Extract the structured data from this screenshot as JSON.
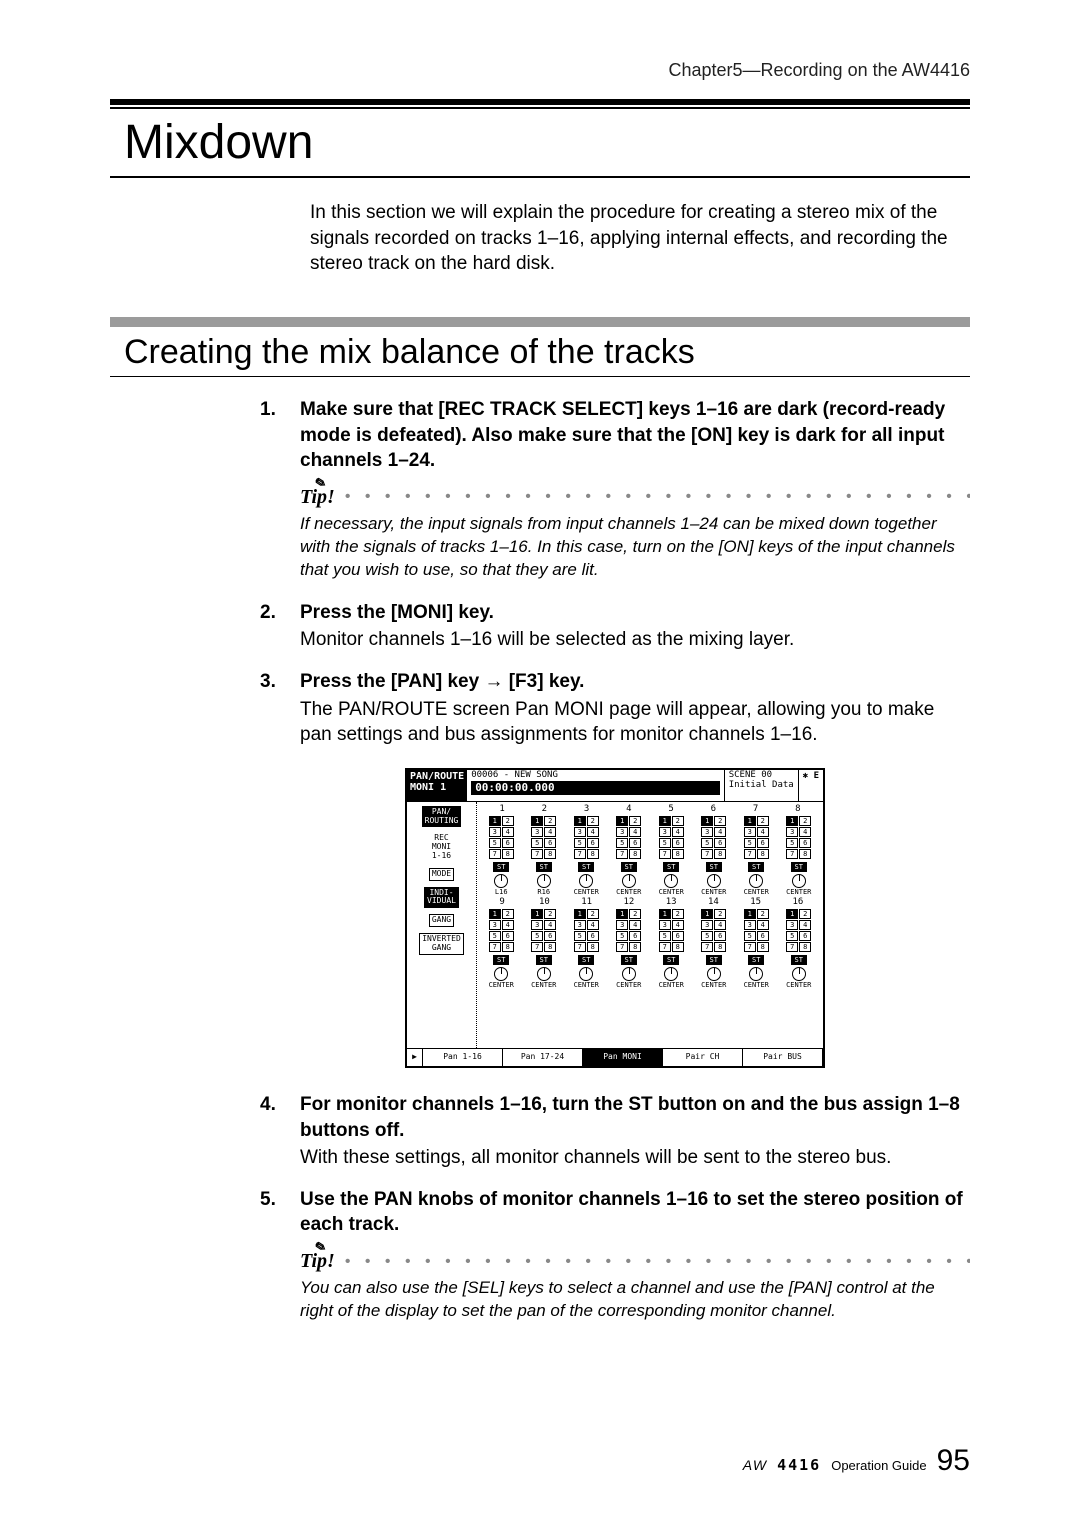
{
  "header": {
    "chapter": "Chapter5—Recording on the AW4416"
  },
  "title_main": "Mixdown",
  "intro_text": "In this section we will explain the procedure for creating a stereo mix of the signals recorded on tracks 1–16, applying internal effects, and recording the stereo track on the hard disk.",
  "title_sub": "Creating the mix balance of the tracks",
  "steps": {
    "s1": {
      "num": "1.",
      "head": "Make sure that [REC TRACK SELECT] keys 1–16 are dark (record-ready mode is defeated). Also make sure that the [ON] key is dark for all input channels 1–24."
    },
    "tip1": {
      "label": "Tip!",
      "text": "If necessary, the input signals from input channels 1–24 can be mixed down together with the signals of tracks 1–16. In this case, turn on the [ON] keys of the input channels that you wish to use, so that they are lit."
    },
    "s2": {
      "num": "2.",
      "head": "Press the [MONI] key.",
      "body": "Monitor channels 1–16 will be selected as the mixing layer."
    },
    "s3": {
      "num": "3.",
      "head": "Press the [PAN] key → [F3] key.",
      "body": "The PAN/ROUTE screen Pan MONI page will appear, allowing you to make pan settings and bus assignments for monitor channels 1–16."
    },
    "s4": {
      "num": "4.",
      "head": "For monitor channels 1–16, turn the ST button on and the bus assign 1–8 buttons off.",
      "body": "With these settings, all monitor channels will be sent to the stereo bus."
    },
    "s5": {
      "num": "5.",
      "head": "Use the PAN knobs of monitor channels 1–16 to set the stereo position of each track."
    },
    "tip2": {
      "label": "Tip!",
      "text": "You can also use the [SEL] keys to select a channel and use the [PAN] control at the right of the display to set the pan of the corresponding monitor channel."
    }
  },
  "screenshot": {
    "screen_name_top": "PAN/ROUTE",
    "screen_name_bot": "MONI 1",
    "song_info": "00006 - NEW SONG",
    "time": "00:00:00.000",
    "scene_label": "SCENE 00",
    "scene_data": "Initial Data",
    "indicator": "E",
    "left_buttons": {
      "b1": "PAN/\nROUTING",
      "b2": "REC\nMONI\n1-16",
      "b3": "MODE",
      "b4": "INDI-\nVIDUAL",
      "b5": "GANG",
      "b6": "INVERTED\nGANG"
    },
    "cols_top": [
      "1",
      "2",
      "3",
      "4",
      "5",
      "6",
      "7",
      "8"
    ],
    "cols_bot": [
      "9",
      "10",
      "11",
      "12",
      "13",
      "14",
      "15",
      "16"
    ],
    "pan_labels": {
      "p1": "L16",
      "p2": "R16",
      "p3": "CENTER",
      "p4": "CENTER",
      "p5": "CENTER",
      "p6": "CENTER",
      "p7": "CENTER",
      "p8": "CENTER",
      "p9": "CENTER",
      "p10": "CENTER",
      "p11": "CENTER",
      "p12": "CENTER",
      "p13": "CENTER",
      "p14": "CENTER",
      "p15": "CENTER",
      "p16": "CENTER"
    },
    "st_label": "ST",
    "bus_nums": [
      "1",
      "2",
      "3",
      "4",
      "5",
      "6",
      "7",
      "8"
    ],
    "tabs": {
      "t1": "Pan 1-16",
      "t2": "Pan 17-24",
      "t3": "Pan MONI",
      "t4": "Pair CH",
      "t5": "Pair BUS"
    }
  },
  "footer": {
    "logo": "AW",
    "model": "4416",
    "guide": "Operation Guide",
    "page": "95"
  }
}
